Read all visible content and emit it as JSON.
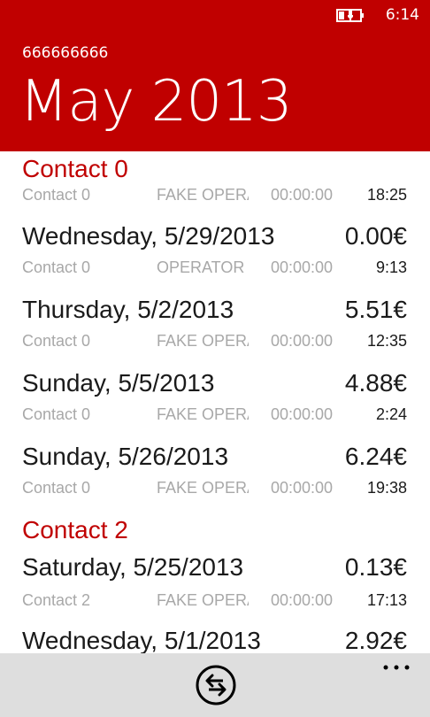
{
  "status_bar": {
    "time": "6:14",
    "battery_icon": "battery-charging-icon"
  },
  "header": {
    "phone_number": "666666666",
    "month_title": "May 2013"
  },
  "groups": [
    {
      "contact": "Contact 0",
      "calls": [
        {
          "title": "",
          "cost": "",
          "contact": "Contact 0",
          "operator": "FAKE OPERATOR",
          "duration": "00:00:00",
          "time": "18:25"
        },
        {
          "title": "Wednesday, 5/29/2013",
          "cost": "0.00€",
          "contact": "Contact 0",
          "operator": "OPERATOR",
          "duration": "00:00:00",
          "time": "9:13"
        },
        {
          "title": "Thursday, 5/2/2013",
          "cost": "5.51€",
          "contact": "Contact 0",
          "operator": "FAKE OPERATOR",
          "duration": "00:00:00",
          "time": "12:35"
        },
        {
          "title": "Sunday, 5/5/2013",
          "cost": "4.88€",
          "contact": "Contact 0",
          "operator": "FAKE OPERATOR",
          "duration": "00:00:00",
          "time": "2:24"
        },
        {
          "title": "Sunday, 5/26/2013",
          "cost": "6.24€",
          "contact": "Contact 0",
          "operator": "FAKE OPERATOR",
          "duration": "00:00:00",
          "time": "19:38"
        }
      ]
    },
    {
      "contact": "Contact 2",
      "calls": [
        {
          "title": "Saturday, 5/25/2013",
          "cost": "0.13€",
          "contact": "Contact 2",
          "operator": "FAKE OPERATOR",
          "duration": "00:00:00",
          "time": "17:13"
        },
        {
          "title": "Wednesday, 5/1/2013",
          "cost": "2.92€",
          "contact": "",
          "operator": "",
          "duration": "",
          "time": ""
        }
      ]
    }
  ],
  "app_bar": {
    "swap_icon": "swap-arrows-icon",
    "more_icon": "ellipsis-icon"
  },
  "colors": {
    "accent": "#c00000",
    "app_bar": "#dedede",
    "secondary_text": "#a8a8a8"
  }
}
